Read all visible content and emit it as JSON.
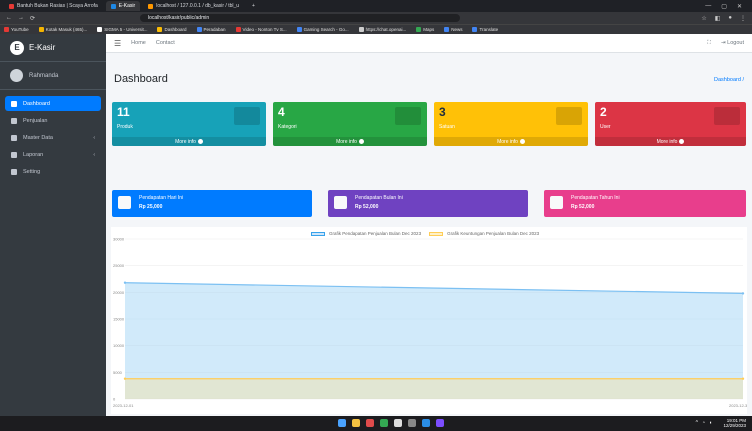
{
  "browser": {
    "tabs": [
      {
        "label": "Bantuh Bukan Rasias | Scaya Arrofa",
        "color": "#e53935"
      },
      {
        "label": "E-Kasir",
        "color": "#1e88e5",
        "active": true
      },
      {
        "label": "localhost / 127.0.0.1 / db_kasir / tbl_u",
        "color": "#ff9800"
      }
    ],
    "url": "localhost/kasir/public/admin",
    "bookmarks": [
      "YouTube",
      "Kotak Masuk (465)...",
      "SIGMA 5 - Universit...",
      "Dashboard",
      "Peradaban",
      "Video - Nonton Tv S...",
      "Gaming Search - Go...",
      "https://chat.openai...",
      "Maps",
      "News",
      "Translate"
    ]
  },
  "sidebar": {
    "brand": "E-Kasir",
    "user": "Rahmanda",
    "items": [
      {
        "label": "Dashboard",
        "active": true
      },
      {
        "label": "Penjualan"
      },
      {
        "label": "Master Data",
        "caret": "‹"
      },
      {
        "label": "Laporan",
        "caret": "‹"
      },
      {
        "label": "Setting"
      }
    ]
  },
  "topnav": {
    "home": "Home",
    "contact": "Contact",
    "logout": "Logout"
  },
  "page": {
    "title": "Dashboard",
    "breadcrumb": "Dashboard /"
  },
  "boxes": [
    {
      "number": "11",
      "label": "Produk",
      "link": "More info",
      "color": "#17a2b8"
    },
    {
      "number": "4",
      "label": "Kategori",
      "link": "More info",
      "color": "#28a745"
    },
    {
      "number": "3",
      "label": "Satuan",
      "link": "More info",
      "color": "#ffc107"
    },
    {
      "number": "2",
      "label": "User",
      "link": "More info",
      "color": "#dc3545"
    }
  ],
  "info_boxes": [
    {
      "title": "Pendapatan Hari Ini",
      "value": "Rp 25,000",
      "color": "#007bff"
    },
    {
      "title": "Pendapatan Bulan Ini",
      "value": "Rp 52,000",
      "color": "#6f42c1"
    },
    {
      "title": "Pendapatan Tahun Ini",
      "value": "Rp 52,000",
      "color": "#e83e8c"
    }
  ],
  "chart_data": {
    "type": "area",
    "series": [
      {
        "name": "Grafik Pendapatan Penjualan Bulan Dec 2023",
        "values": [
          21800,
          19800
        ],
        "color": "#9ad0f5"
      },
      {
        "name": "Grafik Keuntungan Penjualan Bulan Dec 2023",
        "values": [
          3800,
          3800
        ],
        "color": "#ffe08a"
      }
    ],
    "x": [
      "2023-12-01",
      "2023-12-31"
    ],
    "ytick_labels": [
      "0",
      "5000",
      "10000",
      "15000",
      "20000",
      "25000",
      "30000"
    ],
    "xtick_labels": [
      "2023-12-01",
      "2023-12-31"
    ],
    "ylim": [
      0,
      30000
    ]
  },
  "taskbar": {
    "time": "19:01 PM",
    "date": "12/29/2023"
  }
}
